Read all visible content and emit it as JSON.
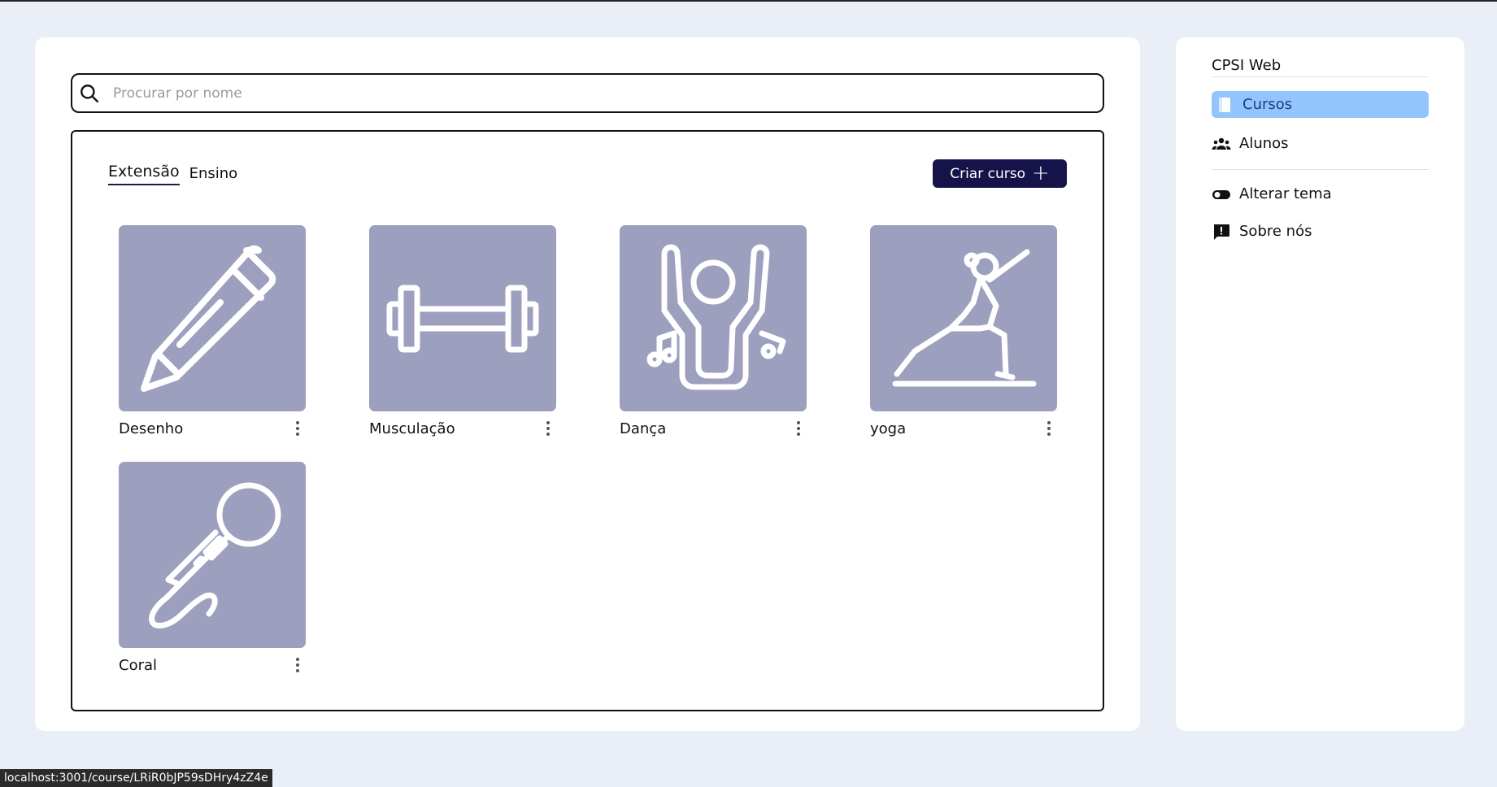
{
  "search": {
    "placeholder": "Procurar por nome"
  },
  "tabs": [
    {
      "label": "Extensão",
      "active": true
    },
    {
      "label": "Ensino",
      "active": false
    }
  ],
  "create_button": {
    "label": "Criar curso"
  },
  "courses": [
    {
      "title": "Desenho",
      "icon": "pencil-icon"
    },
    {
      "title": "Musculação",
      "icon": "dumbbell-icon"
    },
    {
      "title": "Dança",
      "icon": "dancer-icon"
    },
    {
      "title": "yoga",
      "icon": "yoga-icon"
    },
    {
      "title": "Coral",
      "icon": "microphone-icon"
    }
  ],
  "sidebar": {
    "brand": "CPSI Web",
    "items": [
      {
        "label": "Cursos",
        "icon": "book-icon",
        "active": true
      },
      {
        "label": "Alunos",
        "icon": "users-icon",
        "active": false
      },
      {
        "label": "Alterar tema",
        "icon": "toggle-icon",
        "active": false
      },
      {
        "label": "Sobre nós",
        "icon": "feedback-icon",
        "active": false
      }
    ]
  },
  "status_bar": {
    "url": "localhost:3001/course/LRiR0bJP59sDHry4zZ4e"
  },
  "colors": {
    "background": "#e9eef7",
    "thumb": "#9c9fbe",
    "button": "#16134a",
    "active_nav": "#93c5fd"
  }
}
